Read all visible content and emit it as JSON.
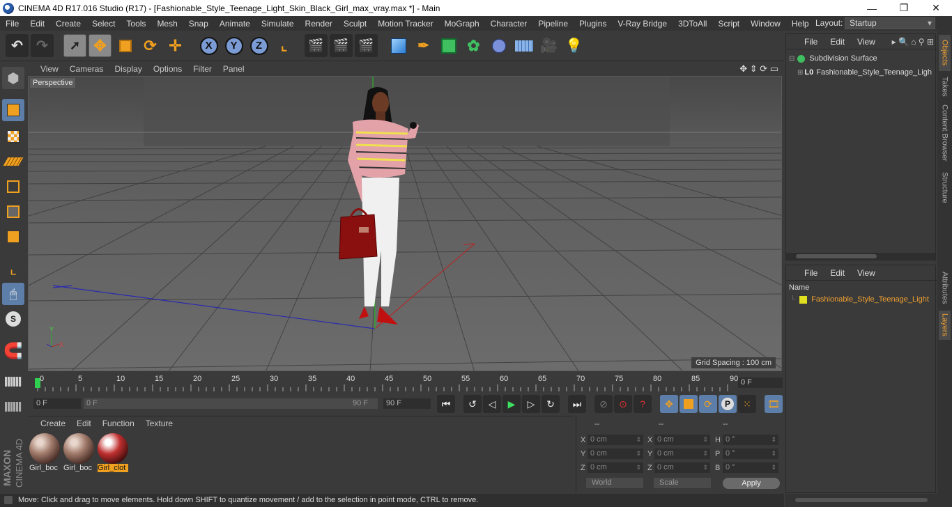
{
  "window": {
    "title": "CINEMA 4D R17.016 Studio (R17) - [Fashionable_Style_Teenage_Light_Skin_Black_Girl_max_vray.max *] - Main",
    "minimize": "—",
    "maximize": "❐",
    "close": "✕"
  },
  "menubar": [
    "File",
    "Edit",
    "Create",
    "Select",
    "Tools",
    "Mesh",
    "Snap",
    "Animate",
    "Simulate",
    "Render",
    "Sculpt",
    "Motion Tracker",
    "MoGraph",
    "Character",
    "Pipeline",
    "Plugins",
    "V-Ray Bridge",
    "3DToAll",
    "Script",
    "Window",
    "Help"
  ],
  "layout": {
    "label": "Layout:",
    "value": "Startup"
  },
  "viewport": {
    "menu": [
      "View",
      "Cameras",
      "Display",
      "Options",
      "Filter",
      "Panel"
    ],
    "camera_label": "Perspective",
    "grid_spacing": "Grid Spacing : 100 cm",
    "axis_y": "Y",
    "axis_x": "X"
  },
  "timeline": {
    "ticks": [
      "0",
      "5",
      "10",
      "15",
      "20",
      "25",
      "30",
      "35",
      "40",
      "45",
      "50",
      "55",
      "60",
      "65",
      "70",
      "75",
      "80",
      "85",
      "90"
    ],
    "current_frame": "0 F"
  },
  "transport": {
    "start_field": "0 F",
    "range_start": "0 F",
    "range_end": "90 F",
    "end_field": "90 F"
  },
  "material_manager": {
    "menu": [
      "Create",
      "Edit",
      "Function",
      "Texture"
    ],
    "materials": [
      {
        "label": "Girl_boc",
        "selected": false
      },
      {
        "label": "Girl_boc",
        "selected": false
      },
      {
        "label": "Girl_clot",
        "selected": true
      }
    ]
  },
  "coordinates": {
    "headers": [
      "--",
      "--",
      "--"
    ],
    "rows": [
      {
        "l1": "X",
        "v1": "0 cm",
        "l2": "X",
        "v2": "0 cm",
        "l3": "H",
        "v3": "0 °"
      },
      {
        "l1": "Y",
        "v1": "0 cm",
        "l2": "Y",
        "v2": "0 cm",
        "l3": "P",
        "v3": "0 °"
      },
      {
        "l1": "Z",
        "v1": "0 cm",
        "l2": "Z",
        "v2": "0 cm",
        "l3": "B",
        "v3": "0 °"
      }
    ],
    "mode1": "World",
    "mode2": "Scale",
    "apply": "Apply"
  },
  "status": "Move: Click and drag to move elements. Hold down SHIFT to quantize movement / add to the selection in point mode, CTRL to remove.",
  "object_manager": {
    "menu": [
      "File",
      "Edit",
      "View"
    ],
    "items": [
      {
        "label": "Subdivision Surface"
      },
      {
        "label": "Fashionable_Style_Teenage_Ligh"
      }
    ]
  },
  "attribute_manager": {
    "menu": [
      "File",
      "Edit",
      "View"
    ],
    "column": "Name",
    "layer": "Fashionable_Style_Teenage_Light"
  },
  "side_tabs": [
    "Objects",
    "Takes",
    "Content Browser",
    "Structure",
    "Attributes",
    "Layers"
  ],
  "branding": {
    "maxon": "MAXON",
    "product": "CINEMA 4D"
  }
}
